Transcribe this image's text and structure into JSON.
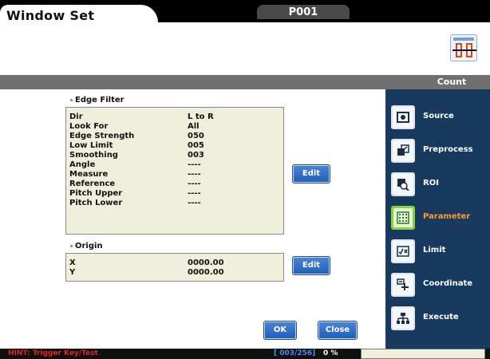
{
  "window": {
    "title": "Window Set",
    "program": "P001"
  },
  "header": {
    "count_label": "Count",
    "count_icon": "counter-icon"
  },
  "edge_filter": {
    "section_title": "Edge Filter",
    "rows": [
      {
        "label": "Dir",
        "value": "L to R"
      },
      {
        "label": "Look For",
        "value": "All"
      },
      {
        "label": "Edge Strength",
        "value": "050"
      },
      {
        "label": "Low Limit",
        "value": "005"
      },
      {
        "label": "Smoothing",
        "value": "003"
      },
      {
        "label": "Angle",
        "value": "----"
      },
      {
        "label": "Measure",
        "value": "----"
      },
      {
        "label": "Reference",
        "value": "----"
      },
      {
        "label": "Pitch Upper",
        "value": "----"
      },
      {
        "label": "Pitch Lower",
        "value": "----"
      }
    ],
    "edit_label": "Edit"
  },
  "origin": {
    "section_title": "Origin",
    "rows": [
      {
        "label": "X",
        "value": "0000.00"
      },
      {
        "label": "Y",
        "value": "0000.00"
      }
    ],
    "edit_label": "Edit"
  },
  "footer_buttons": {
    "ok": "OK",
    "close": "Close"
  },
  "sidebar": {
    "items": [
      {
        "label": "Source",
        "icon": "source-icon",
        "active": false
      },
      {
        "label": "Preprocess",
        "icon": "preprocess-icon",
        "active": false
      },
      {
        "label": "ROI",
        "icon": "roi-icon",
        "active": false
      },
      {
        "label": "Parameter",
        "icon": "parameter-icon",
        "active": true
      },
      {
        "label": "Limit",
        "icon": "limit-icon",
        "active": false
      },
      {
        "label": "Coordinate",
        "icon": "coordinate-icon",
        "active": false
      },
      {
        "label": "Execute",
        "icon": "execute-icon",
        "active": false
      }
    ]
  },
  "status": {
    "hint": "HINT: Trigger Key/Test",
    "counter": "[ 003/256]",
    "percent": "0 %"
  },
  "colors": {
    "sidebar_bg": "#173a5e",
    "active_label": "#ff9933",
    "panel_bg": "#f0efdc",
    "hint": "#e0242a"
  }
}
